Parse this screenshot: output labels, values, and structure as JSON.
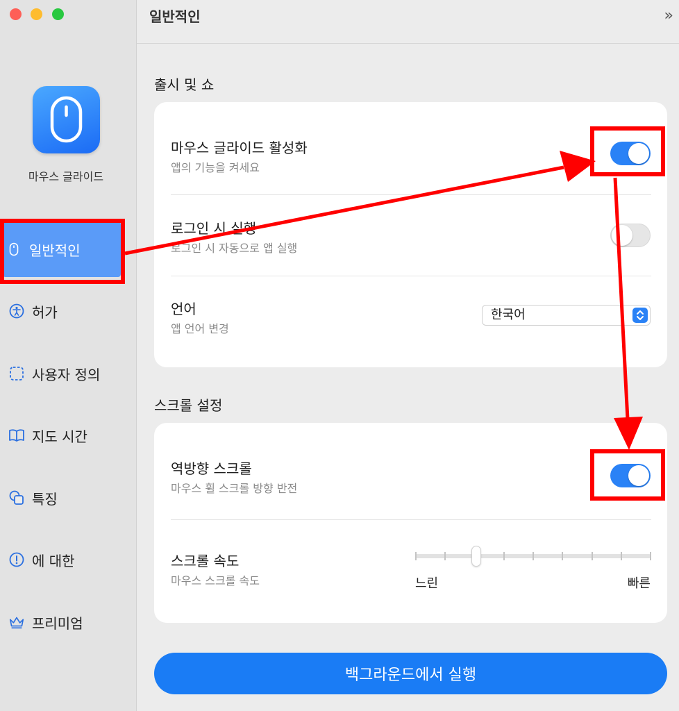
{
  "app": {
    "name": "마우스 글라이드"
  },
  "header": {
    "title": "일반적인",
    "toggle_glyph": "»"
  },
  "sidebar": {
    "items": [
      {
        "label": "일반적인",
        "icon": "mouse-icon",
        "active": true
      },
      {
        "label": "허가",
        "icon": "accessibility-icon"
      },
      {
        "label": "사용자 정의",
        "icon": "dashed-square-icon"
      },
      {
        "label": "지도 시간",
        "icon": "book-icon"
      },
      {
        "label": "특징",
        "icon": "shapes-icon"
      },
      {
        "label": "에 대한",
        "icon": "info-icon"
      },
      {
        "label": "프리미엄",
        "icon": "crown-icon"
      }
    ]
  },
  "sections": {
    "launch": {
      "title": "출시 및 쇼",
      "rows": {
        "enable": {
          "title": "마우스 글라이드 활성화",
          "subtitle": "앱의 기능을 켜세요",
          "on": true
        },
        "login": {
          "title": "로그인 시 실행",
          "subtitle": "로그인 시 자동으로 앱 실행",
          "on": false
        },
        "language": {
          "title": "언어",
          "subtitle": "앱 언어 변경",
          "value": "한국어"
        }
      }
    },
    "scroll": {
      "title": "스크롤 설정",
      "rows": {
        "reverse": {
          "title": "역방향 스크롤",
          "subtitle": "마우스 휠 스크롤 방향 반전",
          "on": true
        },
        "speed": {
          "title": "스크롤 속도",
          "subtitle": "마우스 스크롤 속도",
          "min_label": "느린",
          "max_label": "빠른",
          "value_fraction": 0.26,
          "ticks": 9
        }
      }
    }
  },
  "run_button": {
    "label": "백그라운드에서 실행"
  },
  "colors": {
    "accent": "#2a82f6",
    "annotation": "#ff0000",
    "sidebar_active": "#5a9bf8"
  }
}
